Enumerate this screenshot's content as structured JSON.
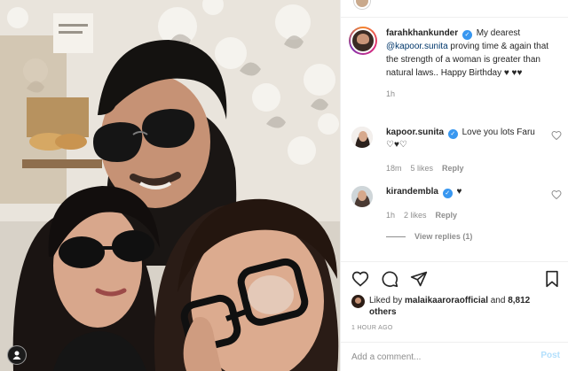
{
  "post": {
    "image_alt": "Selfie of three people, one wearing aviator sunglasses and two wearing dark sunglasses, in front of a white floral wall",
    "caption": {
      "username": "farahkhankunder",
      "mention": "@kapoor.sunita",
      "text_before": "My dearest",
      "text_after": "proving time & again that the strength of a woman is greater than natural laws.. Happy Birthday ♥ ♥♥",
      "time": "1h"
    },
    "comments": [
      {
        "username": "kapoor.sunita",
        "text": "Love you lots Faru ♡♥♡",
        "time": "18m",
        "likes": "5 likes",
        "reply": "Reply"
      },
      {
        "username": "kirandembla",
        "text": "♥",
        "time": "1h",
        "likes": "2 likes",
        "reply": "Reply",
        "view_replies": "View replies (1)"
      }
    ],
    "liked_by": {
      "prefix": "Liked by",
      "name": "malaikaaroraofficial",
      "connector": "and",
      "others": "8,812 others"
    },
    "timestamp": "1 HOUR AGO",
    "add_comment": {
      "placeholder": "Add a comment...",
      "post_label": "Post"
    }
  },
  "colors": {
    "verified": "#3897f0",
    "post_btn_disabled": "#b2dffc",
    "secondary_text": "#8e8e8e"
  },
  "icons": [
    "heart-icon",
    "comment-icon",
    "share-icon",
    "bookmark-icon",
    "verified-icon"
  ]
}
